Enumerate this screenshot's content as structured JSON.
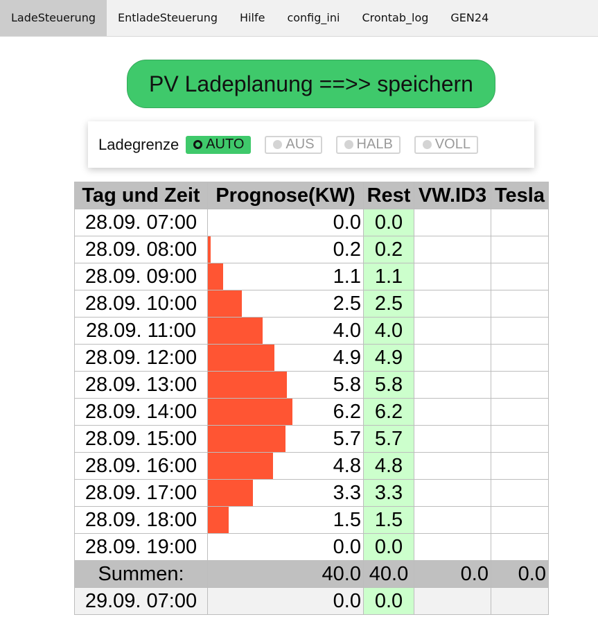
{
  "tabs": [
    {
      "label": "LadeSteuerung",
      "active": true
    },
    {
      "label": "EntladeSteuerung"
    },
    {
      "label": "Hilfe"
    },
    {
      "label": "config_ini"
    },
    {
      "label": "Crontab_log"
    },
    {
      "label": "GEN24"
    }
  ],
  "save_button": {
    "label": "PV Ladeplanung ==>> speichern"
  },
  "ladegrenze": {
    "label": "Ladegrenze",
    "options": [
      {
        "label": "AUTO",
        "selected": true
      },
      {
        "label": "AUS"
      },
      {
        "label": "HALB"
      },
      {
        "label": "VOLL"
      }
    ]
  },
  "table": {
    "headers": [
      "Tag und Zeit",
      "Prognose(KW)",
      "Rest",
      "VW.ID3",
      "Tesla"
    ],
    "max_kw": 6.2,
    "rows": [
      {
        "time": "28.09. 07:00",
        "prognose": "0.0",
        "rest": "0.0",
        "kw": 0.0
      },
      {
        "time": "28.09. 08:00",
        "prognose": "0.2",
        "rest": "0.2",
        "kw": 0.2
      },
      {
        "time": "28.09. 09:00",
        "prognose": "1.1",
        "rest": "1.1",
        "kw": 1.1
      },
      {
        "time": "28.09. 10:00",
        "prognose": "2.5",
        "rest": "2.5",
        "kw": 2.5
      },
      {
        "time": "28.09. 11:00",
        "prognose": "4.0",
        "rest": "4.0",
        "kw": 4.0
      },
      {
        "time": "28.09. 12:00",
        "prognose": "4.9",
        "rest": "4.9",
        "kw": 4.9
      },
      {
        "time": "28.09. 13:00",
        "prognose": "5.8",
        "rest": "5.8",
        "kw": 5.8
      },
      {
        "time": "28.09. 14:00",
        "prognose": "6.2",
        "rest": "6.2",
        "kw": 6.2
      },
      {
        "time": "28.09. 15:00",
        "prognose": "5.7",
        "rest": "5.7",
        "kw": 5.7
      },
      {
        "time": "28.09. 16:00",
        "prognose": "4.8",
        "rest": "4.8",
        "kw": 4.8
      },
      {
        "time": "28.09. 17:00",
        "prognose": "3.3",
        "rest": "3.3",
        "kw": 3.3
      },
      {
        "time": "28.09. 18:00",
        "prognose": "1.5",
        "rest": "1.5",
        "kw": 1.5
      },
      {
        "time": "28.09. 19:00",
        "prognose": "0.0",
        "rest": "0.0",
        "kw": 0.0
      }
    ],
    "summary": {
      "label": "Summen:",
      "prognose": "40.0",
      "rest": "40.0",
      "vw": "0.0",
      "tesla": "0.0"
    },
    "next_row": {
      "time": "29.09. 07:00",
      "prognose": "0.0",
      "rest": "0.0"
    }
  },
  "colors": {
    "accent_green": "#3fc96b",
    "bar_red": "#ff5533",
    "rest_bg": "#ccffcc",
    "header_gray": "#c0c0c0"
  }
}
